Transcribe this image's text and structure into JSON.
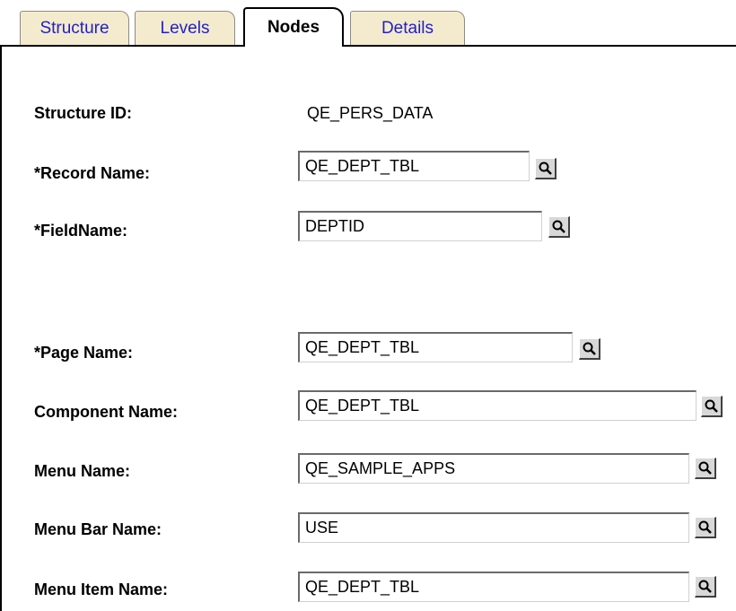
{
  "tabs": [
    {
      "label": "Structure",
      "active": false
    },
    {
      "label": "Levels",
      "active": false
    },
    {
      "label": "Nodes",
      "active": true
    },
    {
      "label": "Details",
      "active": false
    }
  ],
  "form": {
    "structure_id": {
      "label": "Structure ID:",
      "value": "QE_PERS_DATA"
    },
    "record_name": {
      "label": "*Record Name:",
      "value": "QE_DEPT_TBL"
    },
    "field_name": {
      "label": "*FieldName:",
      "value": "DEPTID"
    },
    "page_name": {
      "label": "*Page Name:",
      "value": "QE_DEPT_TBL"
    },
    "component_name": {
      "label": "Component Name:",
      "value": "QE_DEPT_TBL"
    },
    "menu_name": {
      "label": "Menu Name:",
      "value": "QE_SAMPLE_APPS"
    },
    "menu_bar_name": {
      "label": "Menu Bar Name:",
      "value": "USE"
    },
    "menu_item_name": {
      "label": "Menu Item Name:",
      "value": "QE_DEPT_TBL"
    }
  },
  "colors": {
    "tab_inactive_bg": "#f4ebcf",
    "tab_inactive_text": "#1f1fcc"
  },
  "icons": {
    "lookup": "magnifier-icon"
  }
}
